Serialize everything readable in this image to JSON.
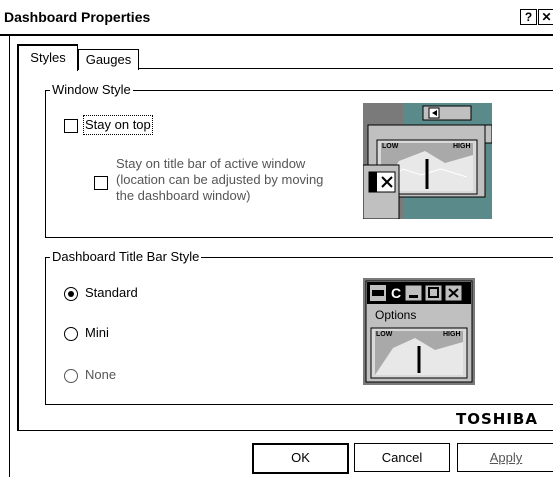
{
  "window": {
    "title": "Dashboard Properties",
    "help_glyph": "?",
    "close_glyph": "✕"
  },
  "tabs": [
    {
      "label": "Styles",
      "active": true
    },
    {
      "label": "Gauges",
      "active": false
    }
  ],
  "window_style": {
    "group_label": "Window Style",
    "stay_on_top_label": "Stay on top",
    "stay_on_title_bar_lines": [
      "Stay on title bar of active window",
      "(location can be adjusted by moving",
      "the dashboard window)"
    ],
    "preview_gauge_low": "LOW",
    "preview_gauge_high": "HIGH"
  },
  "title_bar_style": {
    "group_label": "Dashboard Title Bar Style",
    "options": [
      {
        "label": "Standard",
        "selected": true,
        "enabled": true
      },
      {
        "label": "Mini",
        "selected": false,
        "enabled": true
      },
      {
        "label": "None",
        "selected": false,
        "enabled": false
      }
    ],
    "preview_options_label": "Options",
    "preview_c_glyph": "C",
    "preview_gauge_low": "LOW",
    "preview_gauge_high": "HIGH"
  },
  "brand": "TOSHIBA",
  "buttons": {
    "ok": "OK",
    "cancel": "Cancel",
    "apply": "Apply"
  },
  "colors": {
    "preview_bg": "#808080",
    "preview_window": "#c0c0c0",
    "preview_teal": "#008080"
  }
}
